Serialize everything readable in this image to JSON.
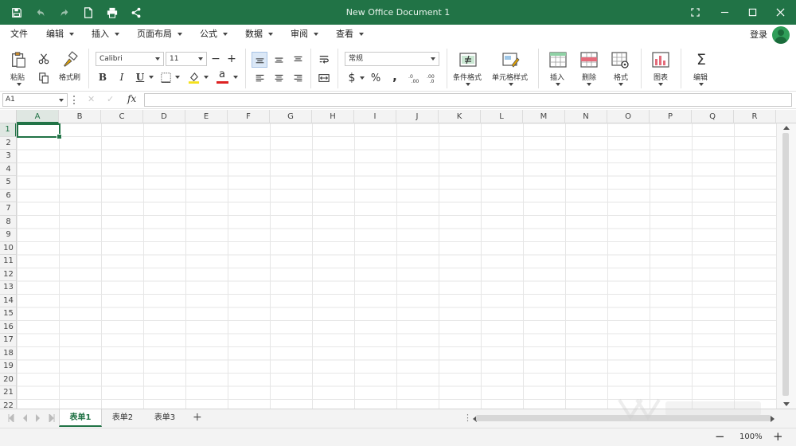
{
  "window": {
    "title": "New Office Document 1"
  },
  "quick_access": [
    "save-icon",
    "undo-icon",
    "redo-icon",
    "new-document-icon",
    "print-icon",
    "share-icon"
  ],
  "menu": {
    "items": [
      {
        "label": "文件"
      },
      {
        "label": "编辑"
      },
      {
        "label": "插入"
      },
      {
        "label": "页面布局"
      },
      {
        "label": "公式"
      },
      {
        "label": "数据"
      },
      {
        "label": "审阅"
      },
      {
        "label": "查看"
      }
    ],
    "login": "登录"
  },
  "ribbon": {
    "paste": "粘贴",
    "format_painter": "格式刷",
    "font_name": "Calibri",
    "font_size": "11",
    "bold": "B",
    "italic": "I",
    "underline": "U",
    "number_format": "常规",
    "currency": "$",
    "percent": "%",
    "comma": ",",
    "conditional_format": "条件格式",
    "cell_style": "单元格样式",
    "insert": "插入",
    "delete": "删除",
    "format": "格式",
    "chart": "图表",
    "sum_symbol": "Σ",
    "edit": "编辑"
  },
  "formula_bar": {
    "cell_ref": "A1",
    "fx": "fx",
    "cancel": "✕",
    "confirm": "✓",
    "value": ""
  },
  "columns": [
    "A",
    "B",
    "C",
    "D",
    "E",
    "F",
    "G",
    "H",
    "I",
    "J",
    "K",
    "L",
    "M",
    "N",
    "O",
    "P",
    "Q",
    "R"
  ],
  "rows": [
    "1",
    "2",
    "3",
    "4",
    "5",
    "6",
    "7",
    "8",
    "9",
    "10",
    "11",
    "12",
    "13",
    "14",
    "15",
    "16",
    "17",
    "18",
    "19",
    "20",
    "21",
    "22"
  ],
  "selected_cell": "A1",
  "sheets": [
    {
      "label": "表单1",
      "active": true
    },
    {
      "label": "表单2",
      "active": false
    },
    {
      "label": "表单3",
      "active": false
    }
  ],
  "status": {
    "zoom": "100%",
    "minus": "−",
    "plus": "+"
  },
  "colors": {
    "accent": "#217346"
  }
}
